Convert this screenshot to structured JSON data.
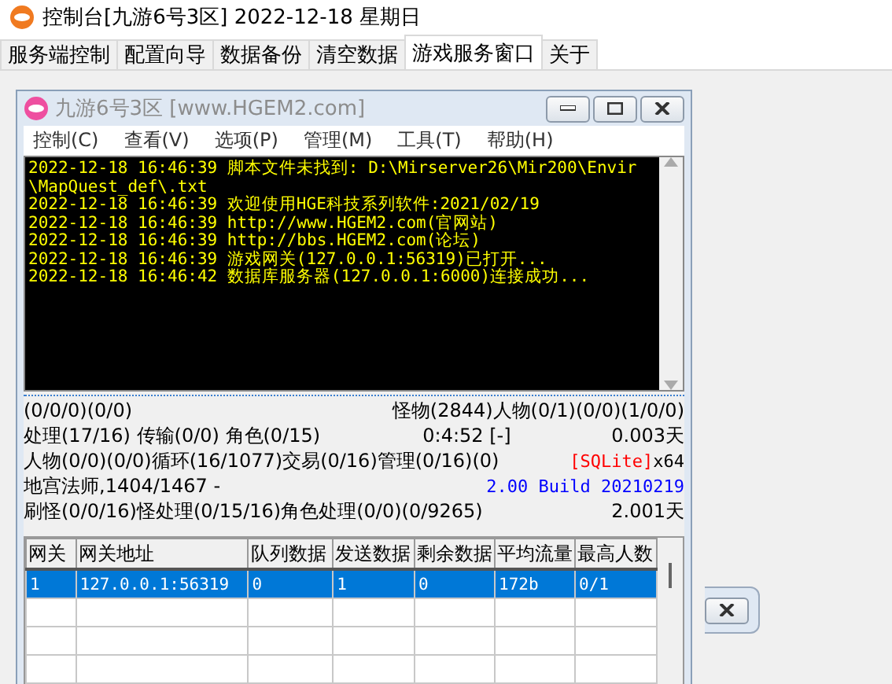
{
  "window": {
    "title": "控制台[九游6号3区] 2022-12-18 星期日"
  },
  "tabs": [
    {
      "label": "服务端控制",
      "selected": false
    },
    {
      "label": "配置向导",
      "selected": false
    },
    {
      "label": "数据备份",
      "selected": false
    },
    {
      "label": "清空数据",
      "selected": false
    },
    {
      "label": "游戏服务窗口",
      "selected": true
    },
    {
      "label": "关于",
      "selected": false
    }
  ],
  "inner_window": {
    "title": "九游6号3区 [www.HGEM2.com]",
    "menu": [
      "控制(C)",
      "查看(V)",
      "选项(P)",
      "管理(M)",
      "工具(T)",
      "帮助(H)"
    ],
    "log": [
      "2022-12-18 16:46:39 脚本文件未找到: D:\\Mirserver26\\Mir200\\Envir\\MapQuest_def\\.txt",
      "2022-12-18 16:46:39 欢迎使用HGE科技系列软件:2021/02/19",
      "2022-12-18 16:46:39 http://www.HGEM2.com(官网站)",
      "2022-12-18 16:46:39 http://bbs.HGEM2.com(论坛)",
      "2022-12-18 16:46:39 游戏网关(127.0.0.1:56319)已打开...",
      "2022-12-18 16:46:42 数据库服务器(127.0.0.1:6000)连接成功..."
    ],
    "status": [
      {
        "left": "(0/0/0)(0/0)",
        "right": [
          "怪物(2844)人物(0/1)(0/0)(1/0/0)"
        ]
      },
      {
        "left": "处理(17/16) 传输(0/0) 角色(0/15)",
        "middle": "0:4:52 [-]",
        "right": [
          "0.003天"
        ]
      },
      {
        "left": "人物(0/0)(0/0)循环(16/1077)交易(0/16)管理(0/16)(0)",
        "right_parts": [
          {
            "text": "[SQLite]",
            "color": "#ff0000"
          },
          {
            "text": "x64",
            "color": "#000000"
          }
        ]
      },
      {
        "left": "地宫法师,1404/1467 -",
        "right_parts": [
          {
            "text": "2.00 Build 20210219",
            "color": "#0000ff"
          }
        ]
      },
      {
        "left": "刷怪(0/0/16)怪处理(0/15/16)角色处理(0/0)(0/9265)",
        "right": [
          "2.001天"
        ]
      }
    ],
    "table": {
      "columns": [
        "网关",
        "网关地址",
        "队列数据",
        "发送数据",
        "剩余数据",
        "平均流量",
        "最高人数"
      ],
      "rows": [
        {
          "cells": [
            "1",
            "127.0.0.1:56319",
            "0",
            "1",
            "0",
            "172b",
            "0/1"
          ],
          "selected": true
        }
      ]
    }
  }
}
